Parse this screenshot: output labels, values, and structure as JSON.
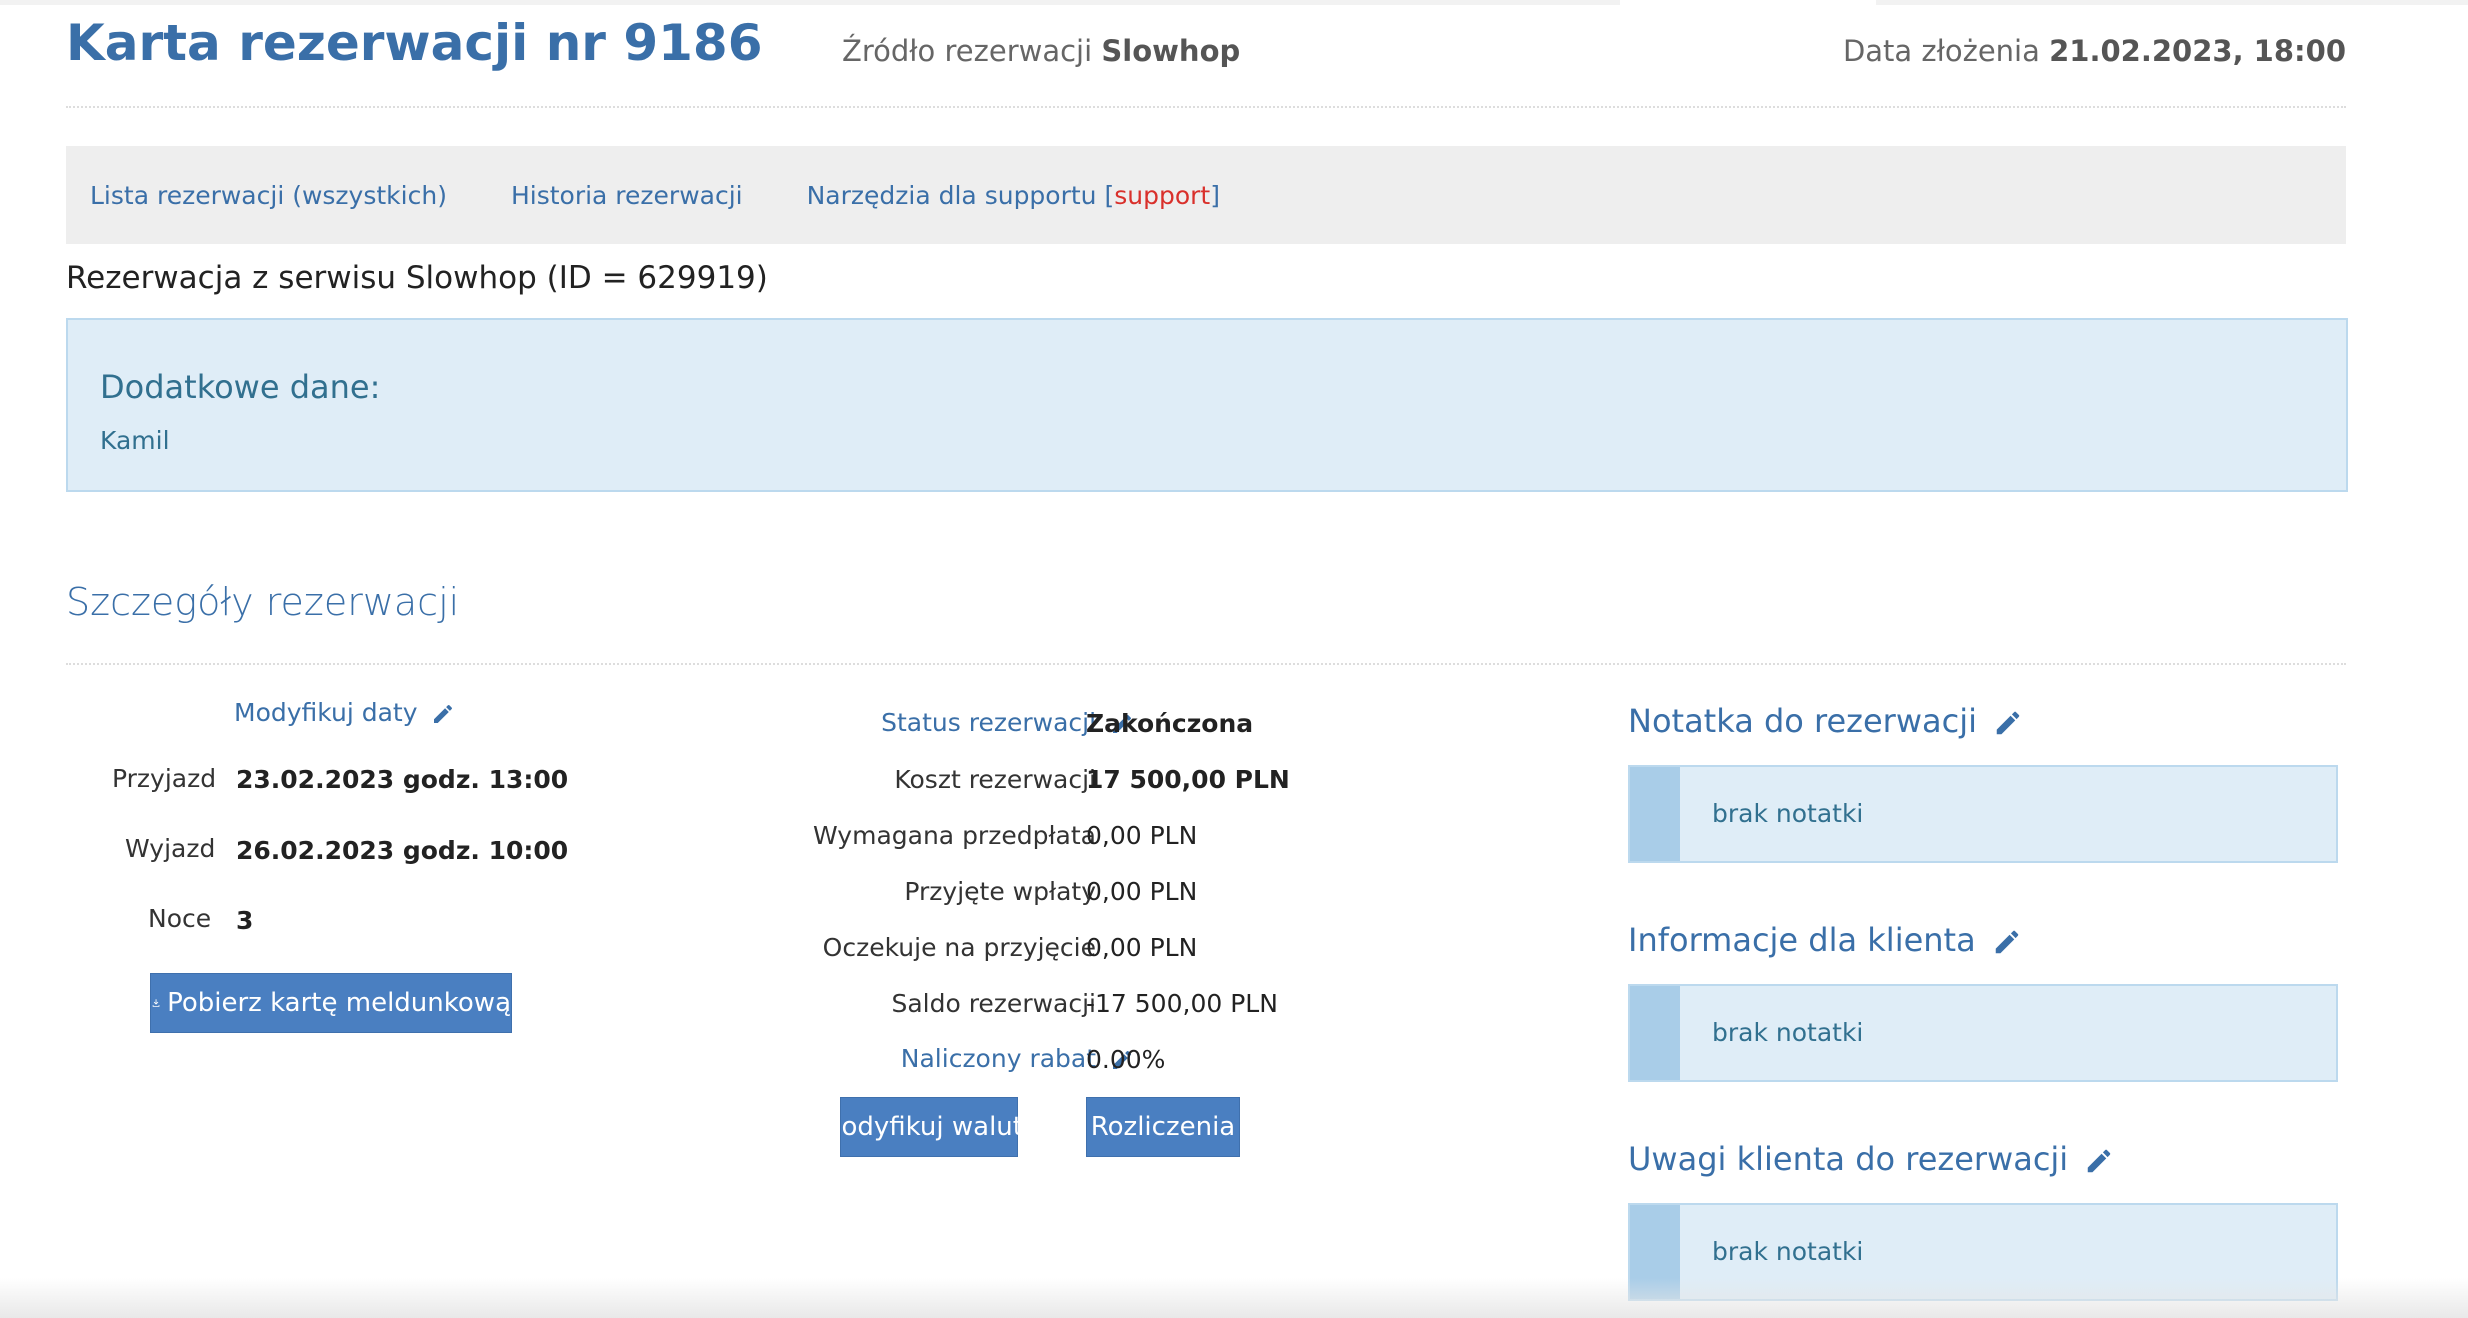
{
  "header": {
    "title": "Karta rezerwacji nr 9186",
    "source_label": "Źródło rezerwacji",
    "source_value": "Slowhop",
    "date_label": "Data złożenia",
    "date_value": "21.02.2023, 18:00"
  },
  "nav": {
    "items": [
      {
        "label": "Lista rezerwacji (wszystkich)"
      },
      {
        "label": "Historia rezerwacji"
      },
      {
        "label": "Narzędzia dla supportu [",
        "tag": "support",
        "close": "]"
      }
    ]
  },
  "subtitle": "Rezerwacja z serwisu Slowhop (ID = 629919)",
  "extra": {
    "title": "Dodatkowe dane:",
    "value": "Kamil"
  },
  "section_title": "Szczegóły rezerwacji",
  "dates": {
    "modify_link": "Modyfikuj daty",
    "arrival_label": "Przyjazd",
    "arrival_value": "23.02.2023 godz. 13:00",
    "departure_label": "Wyjazd",
    "departure_value": "26.02.2023 godz. 10:00",
    "nights_label": "Noce",
    "nights_value": "3",
    "download_button": "Pobierz kartę meldunkową"
  },
  "status": {
    "status_link": "Status rezerwacji",
    "status_value": "Zakończona",
    "rows": [
      {
        "label": "Koszt rezerwacji",
        "value": "17 500,00 PLN",
        "bold": true
      },
      {
        "label": "Wymagana przedpłata",
        "value": "0,00 PLN",
        "bold": false
      },
      {
        "label": "Przyjęte wpłaty",
        "value": "0,00 PLN",
        "bold": false
      },
      {
        "label": "Oczekuje na przyjęcie",
        "value": "0,00 PLN",
        "bold": false
      },
      {
        "label": "Saldo rezerwacji",
        "value": "-17 500,00 PLN",
        "bold": false
      }
    ],
    "discount_link": "Naliczony rabat",
    "discount_value": "0.00%",
    "currency_button": "Modyfikuj walutę",
    "settlements_button": "Rozliczenia"
  },
  "notes": [
    {
      "title": "Notatka do rezerwacji",
      "text": "brak notatki"
    },
    {
      "title": "Informacje dla klienta",
      "text": "brak notatki"
    },
    {
      "title": "Uwagi klienta do rezerwacji",
      "text": "brak notatki"
    }
  ],
  "colors": {
    "accent": "#3a6fa8",
    "button": "#4a7fc1",
    "info_bg": "#dfedf7",
    "support_red": "#d9302b"
  }
}
